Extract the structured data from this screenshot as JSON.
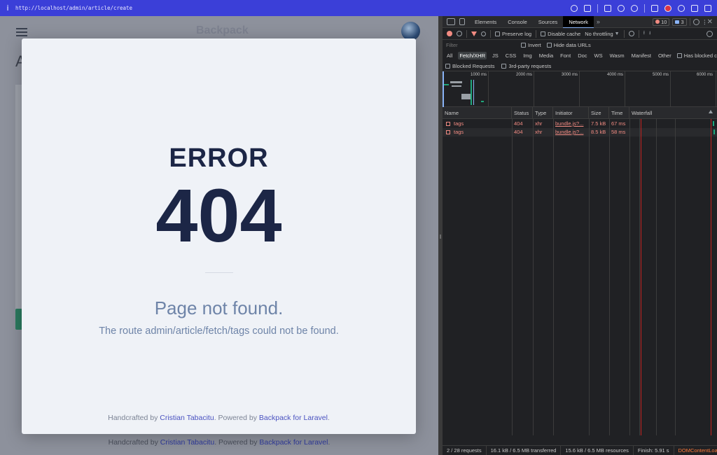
{
  "browser": {
    "url": "http://localhost/admin/article/create"
  },
  "page": {
    "brand": "Backpack",
    "bg_heading_letter": "A",
    "footer": {
      "prefix": "Handcrafted by",
      "author": "Cristian Tabacitu",
      "middle": ". Powered by",
      "product": "Backpack for Laravel",
      "suffix": "."
    }
  },
  "modal": {
    "error_label": "ERROR",
    "error_code": "404",
    "title": "Page not found.",
    "message": "The route admin/article/fetch/tags could not be found.",
    "footer": {
      "prefix": "Handcrafted by",
      "author": "Cristian Tabacitu",
      "middle": ". Powered by",
      "product": "Backpack for Laravel",
      "suffix": "."
    }
  },
  "devtools": {
    "tabs": [
      "Elements",
      "Console",
      "Sources",
      "Network"
    ],
    "active_tab": "Network",
    "error_count": "10",
    "message_count": "3",
    "toolbar": {
      "preserve_log": "Preserve log",
      "disable_cache": "Disable cache",
      "throttling": "No throttling"
    },
    "filter": {
      "placeholder": "Filter",
      "invert": "Invert",
      "hide_data_urls": "Hide data URLs"
    },
    "types": [
      "All",
      "Fetch/XHR",
      "JS",
      "CSS",
      "Img",
      "Media",
      "Font",
      "Doc",
      "WS",
      "Wasm",
      "Manifest",
      "Other"
    ],
    "active_type": "Fetch/XHR",
    "has_blocked_cookies": "Has blocked cookies",
    "blocked_requests": "Blocked Requests",
    "third_party": "3rd-party requests",
    "overview_ticks": [
      "1000 ms",
      "2000 ms",
      "3000 ms",
      "4000 ms",
      "5000 ms",
      "6000 ms"
    ],
    "columns": [
      "Name",
      "Status",
      "Type",
      "Initiator",
      "Size",
      "Time",
      "Waterfall"
    ],
    "rows": [
      {
        "name": "tags",
        "status": "404",
        "type": "xhr",
        "initiator": "bundle.js?...",
        "size": "7.5 kB",
        "time": "67 ms"
      },
      {
        "name": "tags",
        "status": "404",
        "type": "xhr",
        "initiator": "bundle.js?...",
        "size": "8.5 kB",
        "time": "58 ms"
      }
    ],
    "status": {
      "requests": "2 / 28 requests",
      "transferred": "16.1 kB / 6.5 MB transferred",
      "resources": "15.6 kB / 6.5 MB resources",
      "finish": "Finish: 5.91 s",
      "dom": "DOMContentLoa"
    },
    "colors": {
      "error": "#f28b82",
      "accent": "#8ab4f8",
      "dom": "#ff7a3a"
    }
  }
}
